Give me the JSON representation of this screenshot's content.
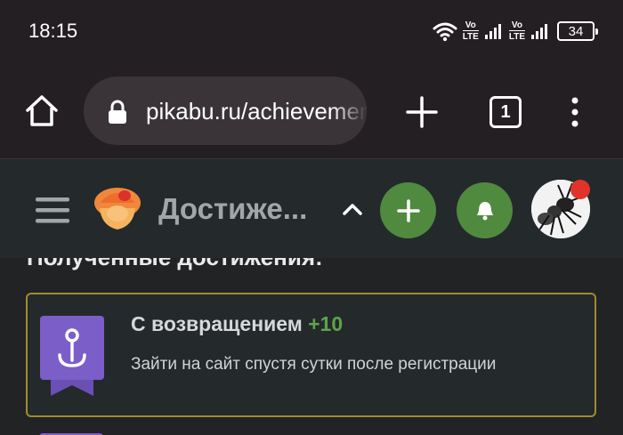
{
  "status_bar": {
    "time": "18:15",
    "volte1_top": "Vo",
    "volte1_bottom": "LTE",
    "volte2_top": "Vo",
    "volte2_bottom": "LTE",
    "battery": "34"
  },
  "browser": {
    "url": "pikabu.ru/achievements",
    "tab_count": "1"
  },
  "header": {
    "title": "Достиже...",
    "accent": "#4f8a3e"
  },
  "content": {
    "section_title": "Полученные достижения:",
    "achievement": {
      "title": "С возвращением",
      "points": "+10",
      "description": "Зайти на сайт спустя сутки после регистрации",
      "badge_icon": "anchor-location-icon",
      "badge_color": "#7b5ec8",
      "border_color": "#a38a2e"
    }
  }
}
